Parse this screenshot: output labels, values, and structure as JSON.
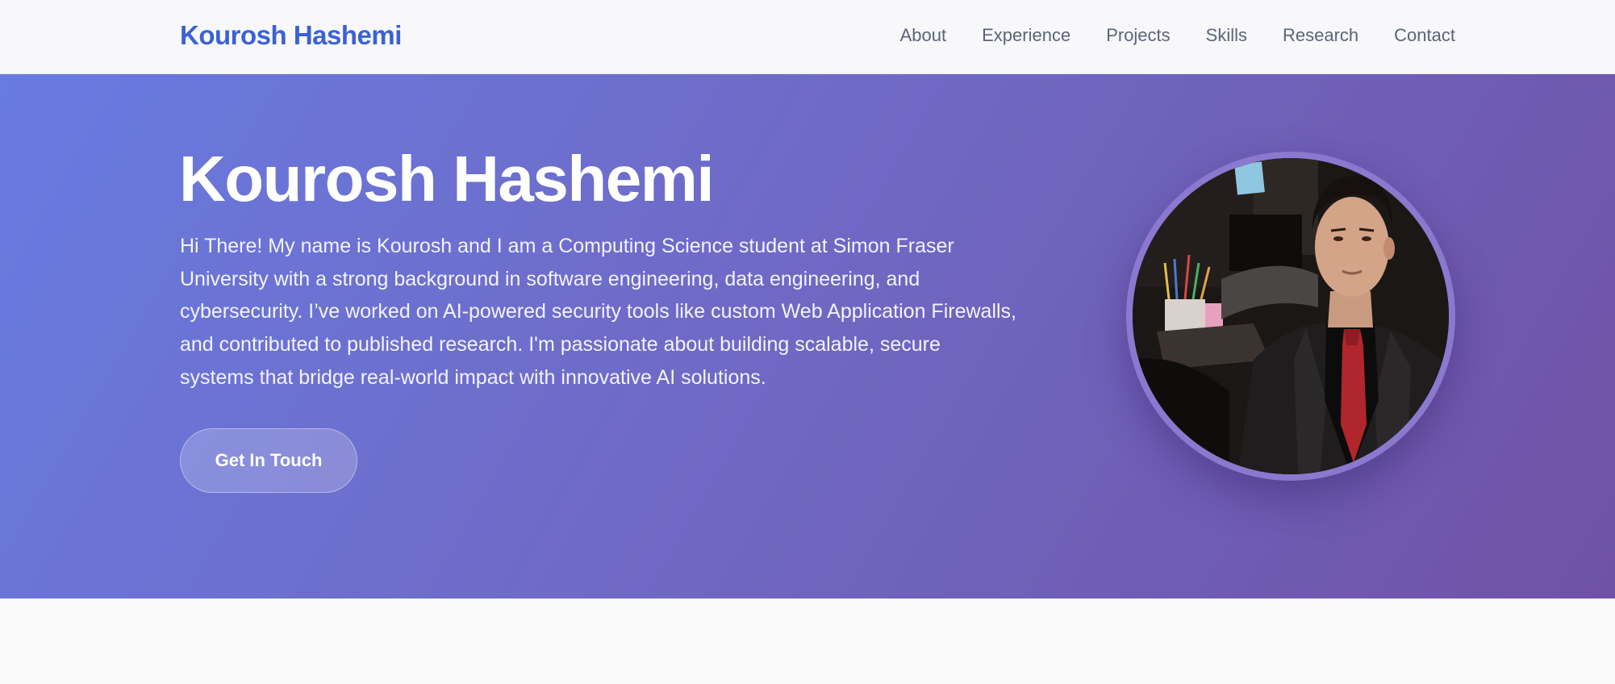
{
  "nav": {
    "brand": "Kourosh Hashemi",
    "links": [
      "About",
      "Experience",
      "Projects",
      "Skills",
      "Research",
      "Contact"
    ]
  },
  "hero": {
    "title": "Kourosh Hashemi",
    "bio": "Hi There! My name is Kourosh and I am a Computing Science student at Simon Fraser University with a strong background in software engineering, data engineering, and cybersecurity. I’ve worked on AI-powered security tools like custom Web Application Firewalls, and contributed to published research. I'm passionate about building scalable, secure systems that bridge real-world impact with innovative AI solutions.",
    "cta_label": "Get In Touch"
  },
  "colors": {
    "brand": "#3a62d6",
    "nav_text": "#5a6478",
    "hero_gradient_start": "#687be0",
    "hero_gradient_end": "#6f52a6",
    "avatar_ring": "#8a79cf"
  }
}
